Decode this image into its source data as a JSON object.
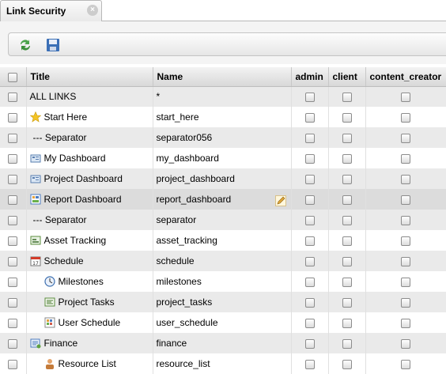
{
  "tab": {
    "title": "Link Security",
    "close": "×"
  },
  "toolbar": {
    "refresh_icon": "refresh-icon",
    "save_icon": "save-icon"
  },
  "columns": [
    "Title",
    "Name",
    "admin",
    "client",
    "content_creator"
  ],
  "rows": [
    {
      "title": "ALL LINKS",
      "name": "*",
      "icon": "none"
    },
    {
      "title": "Start Here",
      "name": "start_here",
      "icon": "star-icon"
    },
    {
      "title": "--- Separator",
      "name": "separator056",
      "icon": "none"
    },
    {
      "title": "My Dashboard",
      "name": "my_dashboard",
      "icon": "dashboard-icon"
    },
    {
      "title": "Project Dashboard",
      "name": "project_dashboard",
      "icon": "dashboard-icon"
    },
    {
      "title": "Report Dashboard",
      "name": "report_dashboard",
      "icon": "report-icon"
    },
    {
      "title": "--- Separator",
      "name": "separator",
      "icon": "none"
    },
    {
      "title": "Asset Tracking",
      "name": "asset_tracking",
      "icon": "asset-icon"
    },
    {
      "title": "Schedule",
      "name": "schedule",
      "icon": "calendar-icon"
    },
    {
      "title": "Milestones",
      "name": "milestones",
      "icon": "clock-icon"
    },
    {
      "title": "Project Tasks",
      "name": "project_tasks",
      "icon": "tasks-icon"
    },
    {
      "title": "User Schedule",
      "name": "user_schedule",
      "icon": "user-schedule-icon"
    },
    {
      "title": "Finance",
      "name": "finance",
      "icon": "finance-icon"
    },
    {
      "title": "Resource List",
      "name": "resource_list",
      "icon": "resource-icon"
    }
  ]
}
